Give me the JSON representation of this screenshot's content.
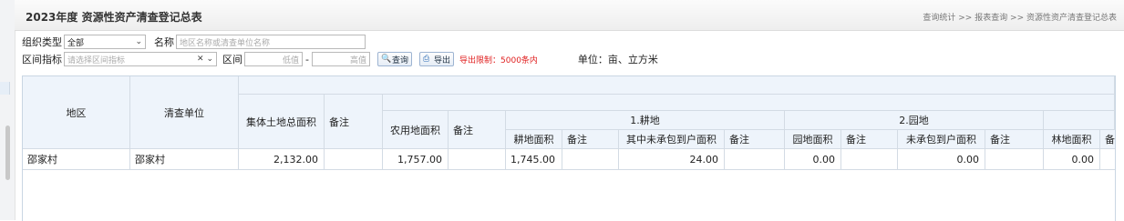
{
  "header": {
    "title": "2023年度 资源性资产清查登记总表",
    "breadcrumb": "查询统计 >> 报表查询 >> 资源性资产清查登记总表"
  },
  "filters": {
    "org_type_label": "组织类型",
    "org_type_value": "全部",
    "name_label": "名称",
    "name_placeholder": "地区名称或清查单位名称",
    "indicator_label": "区间指标",
    "indicator_placeholder": "请选择区间指标",
    "range_label": "区间",
    "low_placeholder": "低值",
    "range_sep": "-",
    "high_placeholder": "高值",
    "query_button": "查询",
    "export_button": "导出",
    "export_limit": "导出限制：5000条内",
    "unit_text": "单位：亩、立方米"
  },
  "table": {
    "headers": {
      "region": "地区",
      "unit": "清查单位",
      "collective_total": "集体土地总面积",
      "remark": "备注",
      "farm_area": "农用地面积",
      "group_cultivated": "1.耕地",
      "cultivated_area": "耕地面积",
      "uncontracted_area": "其中未承包到户面积",
      "group_garden": "2.园地",
      "garden_area": "园地面积",
      "uncontracted_short": "未承包到户面积",
      "forest_area": "林地面积",
      "remark_cut": "备"
    },
    "rows": [
      {
        "region": "邵家村",
        "unit": "邵家村",
        "collective_total": "2,132.00",
        "remark1": "",
        "farm_area": "1,757.00",
        "remark2": "",
        "cultivated_area": "1,745.00",
        "remark3": "",
        "uncontracted_area": "24.00",
        "remark4": "",
        "garden_area": "0.00",
        "remark5": "",
        "garden_uncontracted": "0.00",
        "remark6": "",
        "forest_area": "0.00"
      }
    ]
  }
}
